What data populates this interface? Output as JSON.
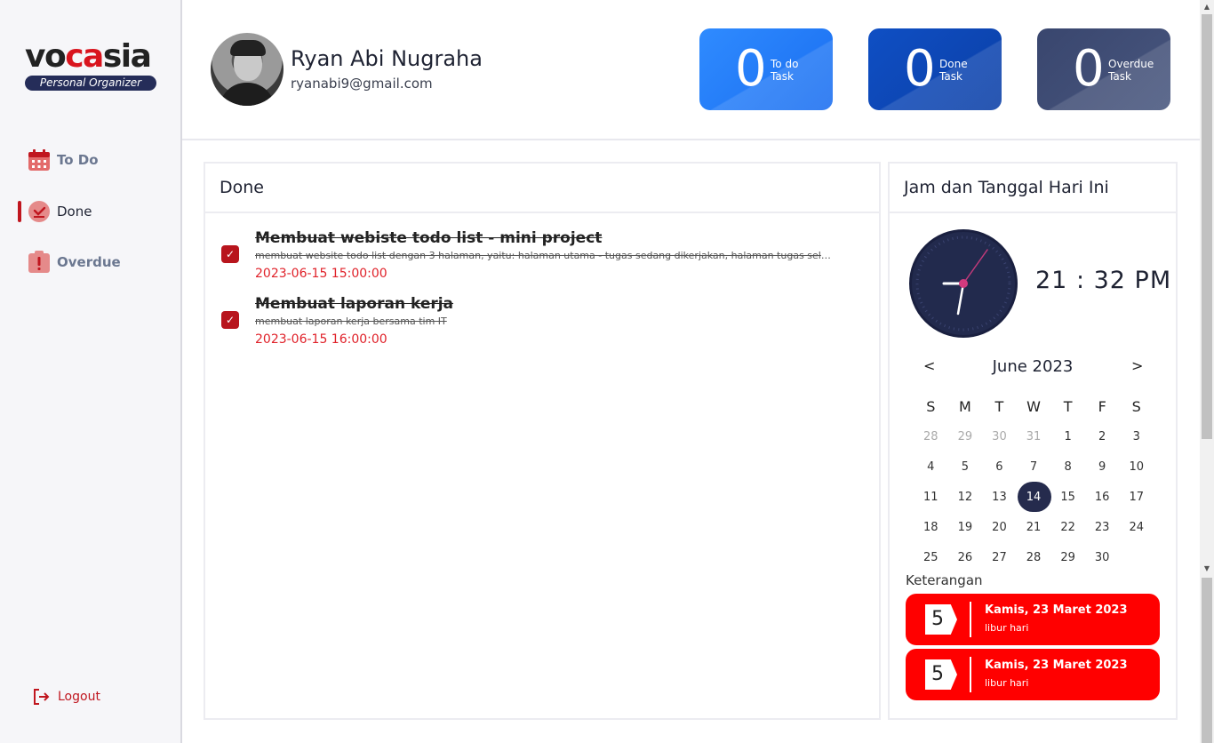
{
  "brand": {
    "logo_pre": "vo",
    "logo_mid": "ca",
    "logo_post": "sia",
    "tagline": "Personal Organizer"
  },
  "sidebar": {
    "items": [
      {
        "label": "To Do",
        "icon": "calendar-icon"
      },
      {
        "label": "Done",
        "icon": "check-circle-icon"
      },
      {
        "label": "Overdue",
        "icon": "alert-clipboard-icon"
      }
    ],
    "logout": "Logout"
  },
  "user": {
    "name": "Ryan Abi Nugraha",
    "email": "ryanabi9@gmail.com"
  },
  "stats": [
    {
      "count": "0",
      "line1": "To do",
      "line2": "Task"
    },
    {
      "count": "0",
      "line1": "Done",
      "line2": "Task"
    },
    {
      "count": "0",
      "line1": "Overdue",
      "line2": "Task"
    }
  ],
  "done_panel": {
    "title": "Done",
    "tasks": [
      {
        "title": "Membuat webiste todo list - mini project",
        "description": "membuat website todo list dengan 3 halaman, yaitu: halaman utama - tugas sedang dikerjakan, halaman tugas selesai,...",
        "date": "2023-06-15 15:00:00"
      },
      {
        "title": "Membuat laporan kerja",
        "description": "membuat laporan kerja bersama tim IT",
        "date": "2023-06-15 16:00:00"
      }
    ]
  },
  "clock_panel": {
    "title": "Jam dan Tanggal Hari Ini",
    "time": "21 : 32 PM",
    "calendar": {
      "prev": "<",
      "next": ">",
      "month": "June 2023",
      "dow": [
        "S",
        "M",
        "T",
        "W",
        "T",
        "F",
        "S"
      ],
      "weeks": [
        [
          "28",
          "29",
          "30",
          "31",
          "1",
          "2",
          "3"
        ],
        [
          "4",
          "5",
          "6",
          "7",
          "8",
          "9",
          "10"
        ],
        [
          "11",
          "12",
          "13",
          "14",
          "15",
          "16",
          "17"
        ],
        [
          "18",
          "19",
          "20",
          "21",
          "22",
          "23",
          "24"
        ],
        [
          "25",
          "26",
          "27",
          "28",
          "29",
          "30",
          ""
        ]
      ],
      "today": "14"
    },
    "legend_label": "Keterangan",
    "holidays": [
      {
        "day": "5",
        "title": "Kamis, 23 Maret 2023",
        "subtitle": "libur hari"
      },
      {
        "day": "5",
        "title": "Kamis, 23 Maret 2023",
        "subtitle": "libur hari"
      }
    ]
  },
  "colors": {
    "brand_red": "#c0161f",
    "todo_blue": "#2f8bff",
    "done_blue": "#0f4fc4",
    "overdue_slate": "#39466e",
    "holiday_red": "#ff0000",
    "navy": "#252d59"
  }
}
